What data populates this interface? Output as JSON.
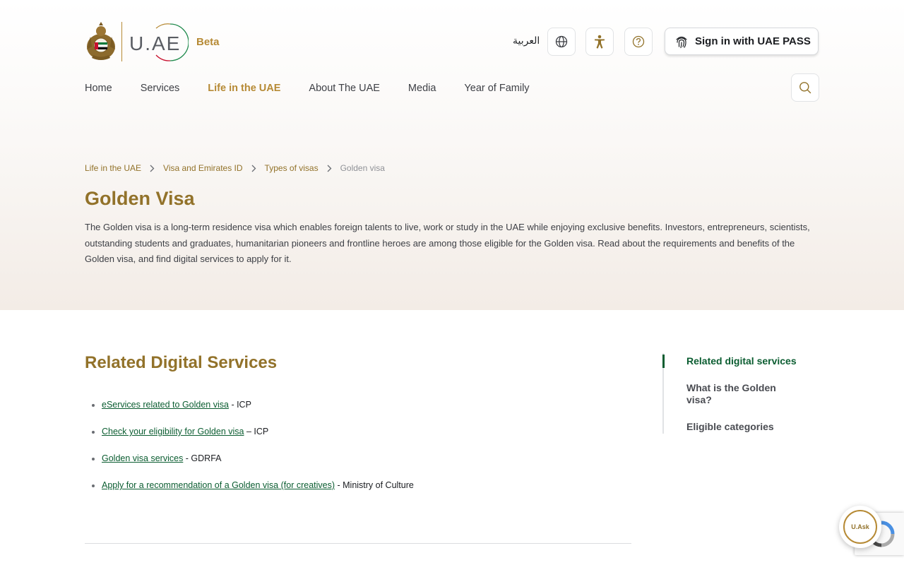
{
  "header": {
    "logo_text": "U.AE",
    "beta_label": "Beta",
    "language_toggle": "العربية",
    "signin_label": "Sign in with UAE PASS",
    "icons": [
      "globe-icon",
      "accessibility-icon",
      "help-icon",
      "fingerprint-icon",
      "search-icon"
    ]
  },
  "nav": {
    "items": [
      {
        "label": "Home",
        "active": false
      },
      {
        "label": "Services",
        "active": false
      },
      {
        "label": "Life in the UAE",
        "active": true
      },
      {
        "label": "About The UAE",
        "active": false
      },
      {
        "label": "Media",
        "active": false
      },
      {
        "label": "Year of Family",
        "active": false
      }
    ]
  },
  "breadcrumb": {
    "items": [
      "Life in the UAE",
      "Visa and Emirates ID",
      "Types of visas",
      "Golden visa"
    ]
  },
  "page": {
    "title": "Golden Visa",
    "intro": "The Golden visa is a long-term residence visa which enables foreign talents to live, work or study in the UAE while enjoying exclusive benefits. Investors, entrepreneurs, scientists, outstanding students and graduates, humanitarian pioneers and frontline heroes are among those eligible for the Golden visa. Read about the requirements and benefits of the Golden visa, and find digital services to apply for it."
  },
  "related": {
    "title": "Related Digital Services",
    "services": [
      {
        "link": "eServices related to Golden visa",
        "suffix": " - ICP"
      },
      {
        "link": "Check your eligibility for Golden visa",
        "suffix": " – ICP"
      },
      {
        "link": "Golden visa services",
        "suffix": " - GDRFA"
      },
      {
        "link": "Apply for a recommendation of a Golden visa (for creatives)",
        "suffix": " - Ministry of Culture"
      }
    ]
  },
  "toc": {
    "items": [
      {
        "label": "Related digital services",
        "active": true
      },
      {
        "label": "What is the Golden visa?",
        "active": false
      },
      {
        "label": "Eligible categories",
        "active": false
      }
    ]
  },
  "chatbot": {
    "label": "U.Ask"
  },
  "colors": {
    "gold": "#b68a35",
    "dark_gold": "#92722a",
    "green": "#0b5d31"
  }
}
